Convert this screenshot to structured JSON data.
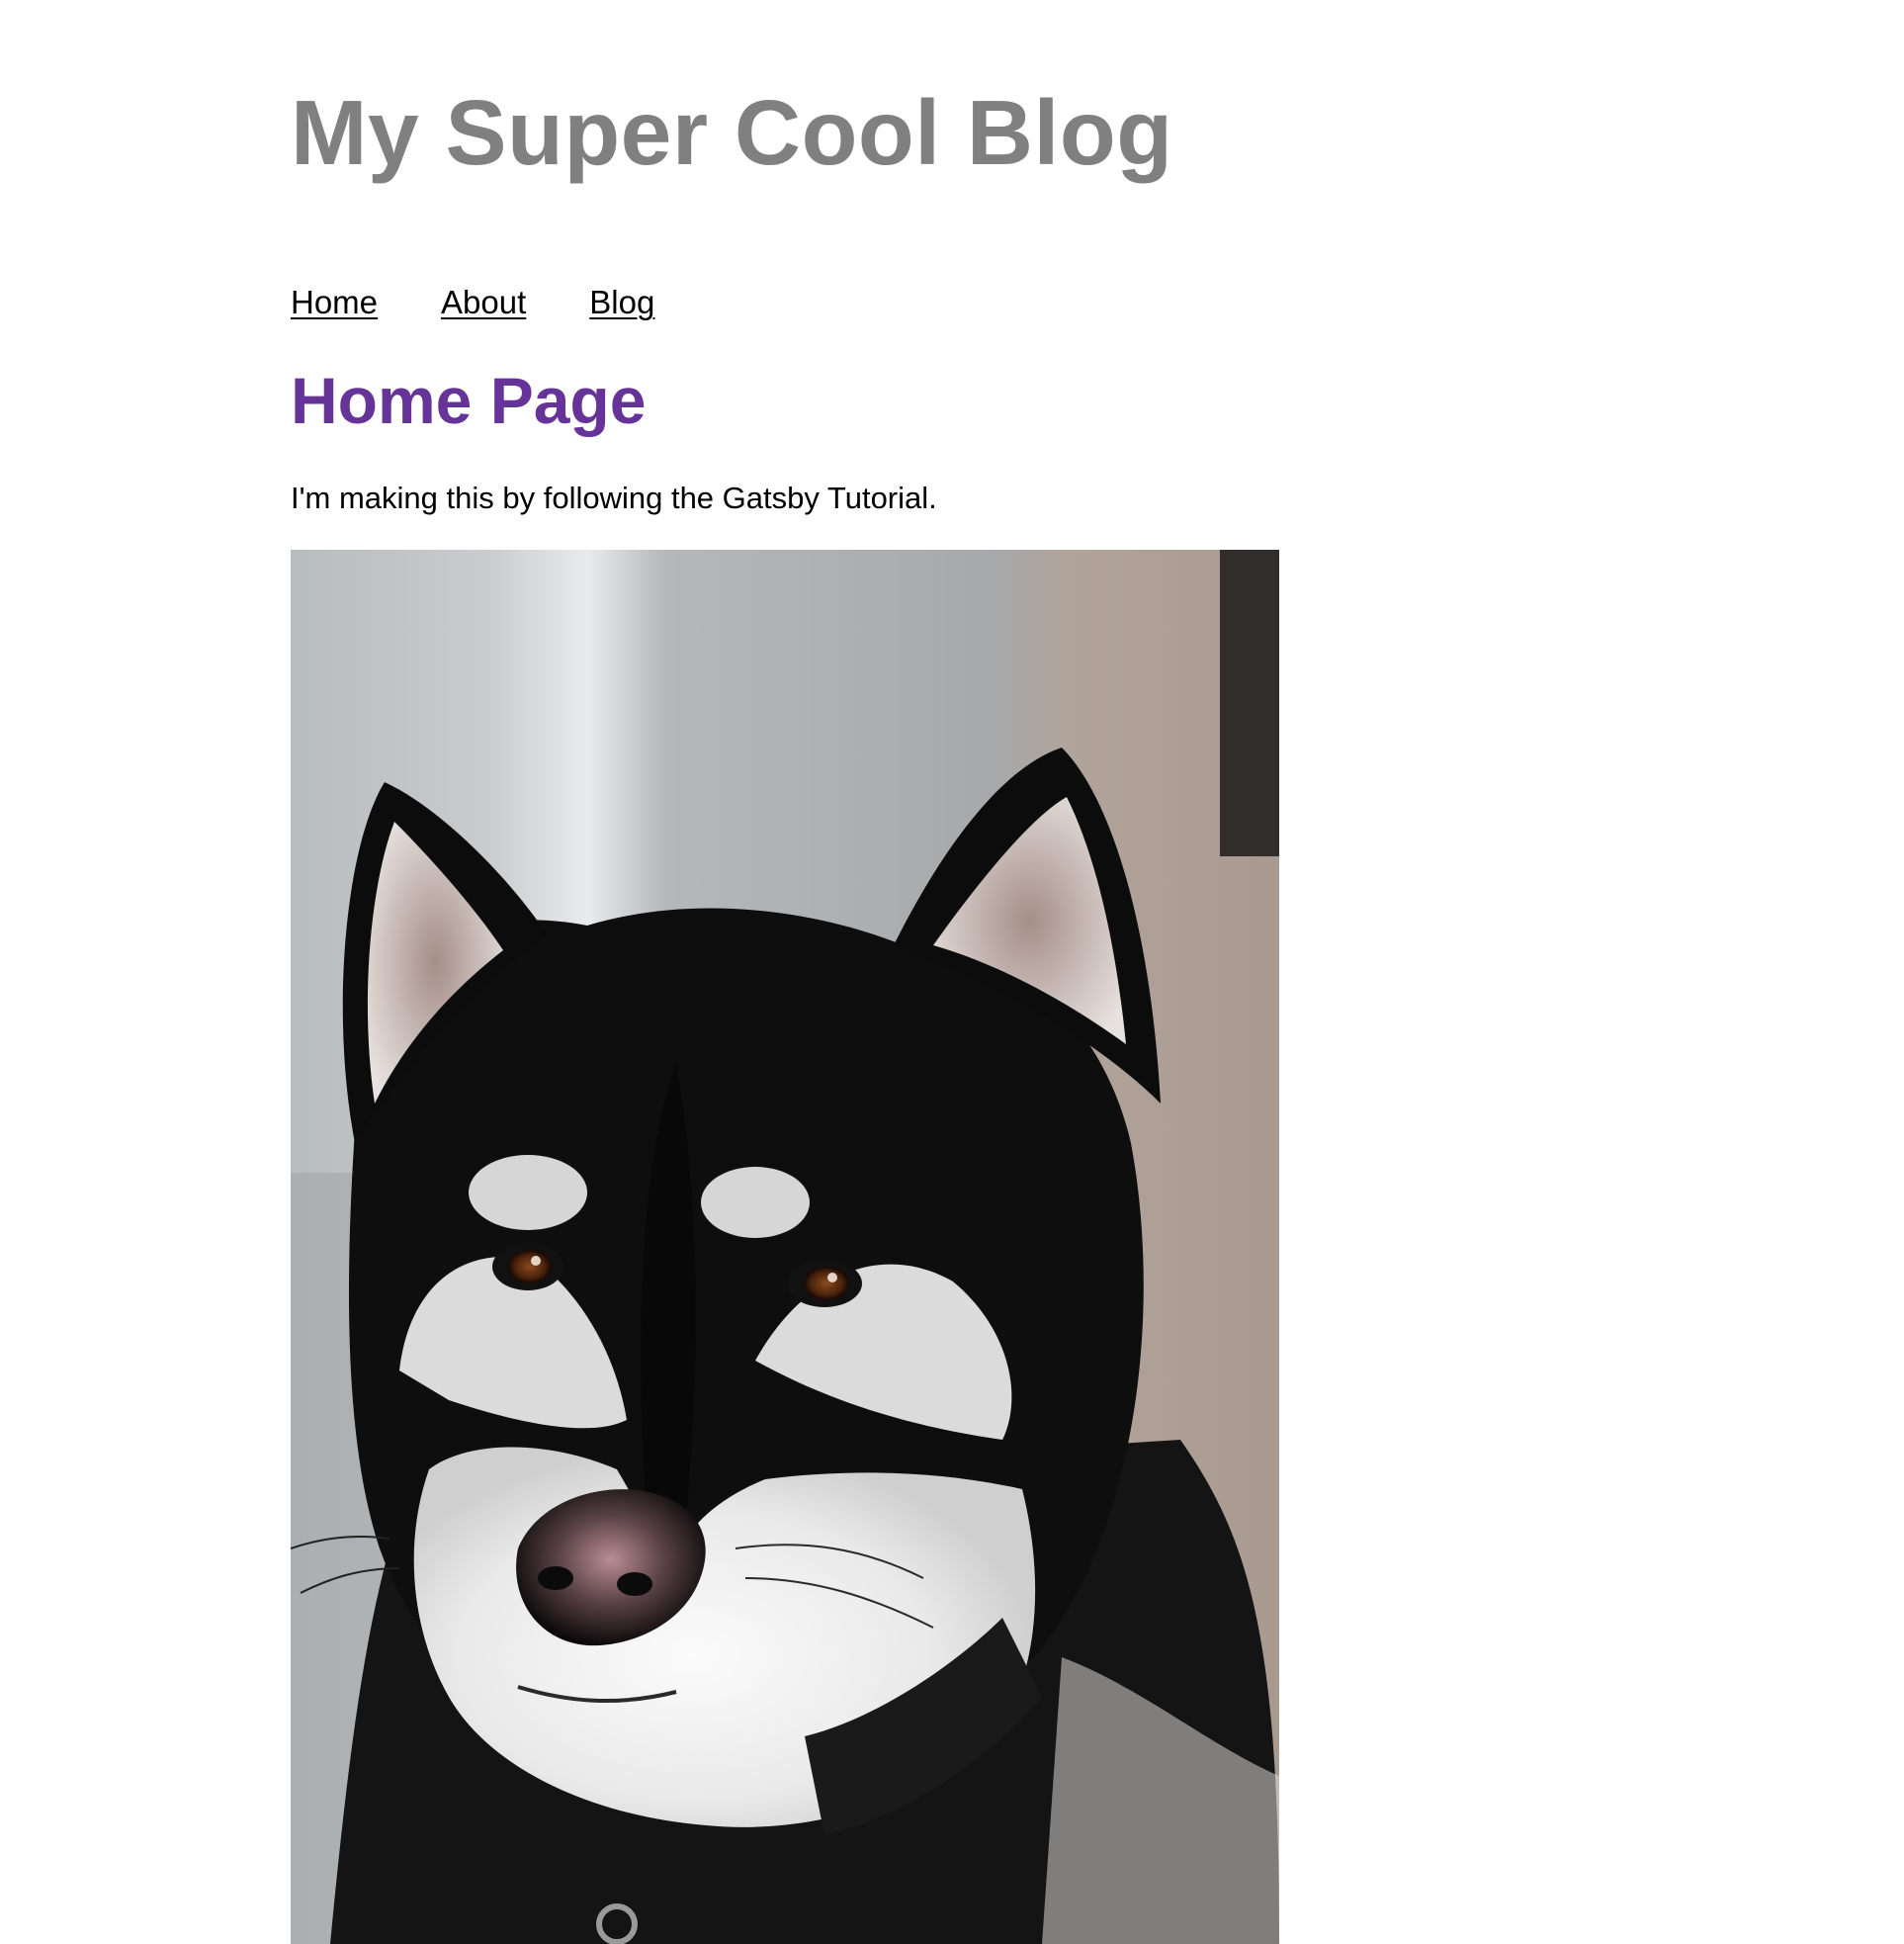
{
  "header": {
    "site_title": "My Super Cool Blog"
  },
  "nav": {
    "items": [
      {
        "label": "Home"
      },
      {
        "label": "About"
      },
      {
        "label": "Blog"
      }
    ]
  },
  "main": {
    "heading": "Home Page",
    "intro": "I'm making this by following the Gatsby Tutorial.",
    "photo": {
      "subject": "husky-dog-photo"
    }
  },
  "colors": {
    "site_title": "#808080",
    "page_heading": "#663399",
    "text": "#000000",
    "background": "#ffffff"
  }
}
